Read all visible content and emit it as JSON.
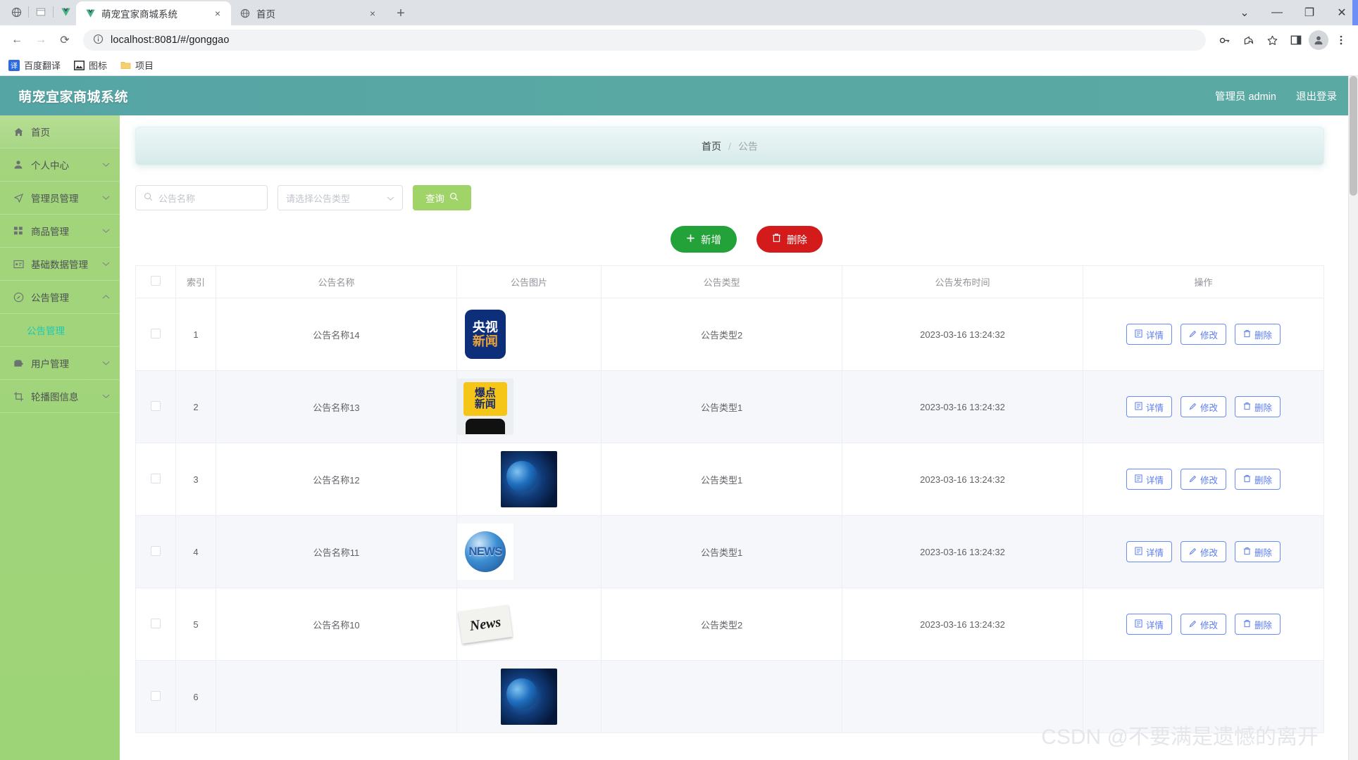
{
  "browser": {
    "tabs": [
      {
        "title": "萌宠宜家商城系统",
        "favicon": "vue-icon",
        "active": true,
        "close_label": "×"
      },
      {
        "title": "首页",
        "favicon": "globe-icon",
        "active": false,
        "close_label": "×"
      }
    ],
    "new_tab_label": "+",
    "leading_icons": [
      "globe-icon",
      "window-icon",
      "vue-icon"
    ],
    "window_controls": {
      "minimize": "—",
      "maximize": "❐",
      "close": "✕",
      "tab_search": "⌄"
    },
    "nav": {
      "back": "←",
      "forward": "→",
      "reload": "⟳"
    },
    "omnibox": {
      "info_icon": "info-circle-icon",
      "host": "localhost:8081",
      "path": "/#/gonggao",
      "full_url": "localhost:8081/#/gonggao"
    },
    "toolbar_icons": [
      "key-icon",
      "share-icon",
      "star-icon",
      "sidepanel-icon",
      "profile-icon",
      "menu-icon"
    ],
    "bookmarks": [
      {
        "label": "百度翻译",
        "icon": "translate-icon",
        "icon_text": "译",
        "icon_color": "#2d6ae0"
      },
      {
        "label": "图标",
        "icon": "image-icon",
        "icon_text": "",
        "icon_color": "#2b2b2b"
      },
      {
        "label": "项目",
        "icon": "folder-icon",
        "icon_text": "",
        "icon_color": "#f2cb50"
      }
    ]
  },
  "app": {
    "title": "萌宠宜家商城系统",
    "header": {
      "user_label": "管理员 admin",
      "logout_label": "退出登录"
    },
    "sidebar": {
      "items": [
        {
          "label": "首页",
          "icon": "home-icon",
          "has_arrow": false,
          "expanded": false,
          "active": true
        },
        {
          "label": "个人中心",
          "icon": "user-icon",
          "has_arrow": true,
          "expanded": false,
          "active": false
        },
        {
          "label": "管理员管理",
          "icon": "navigation-icon",
          "has_arrow": true,
          "expanded": false,
          "active": false
        },
        {
          "label": "商品管理",
          "icon": "grid-icon",
          "has_arrow": true,
          "expanded": false,
          "active": false
        },
        {
          "label": "基础数据管理",
          "icon": "postcard-icon",
          "has_arrow": true,
          "expanded": false,
          "active": false
        },
        {
          "label": "公告管理",
          "icon": "dial-icon",
          "has_arrow": true,
          "expanded": true,
          "active": false
        },
        {
          "label": "用户管理",
          "icon": "wallet-icon",
          "has_arrow": true,
          "expanded": false,
          "active": false
        },
        {
          "label": "轮播图信息",
          "icon": "crop-icon",
          "has_arrow": true,
          "expanded": false,
          "active": false
        }
      ],
      "submenu": {
        "label": "公告管理",
        "parent_index": 5,
        "active": true
      }
    },
    "breadcrumb": {
      "home": "首页",
      "separator": "/",
      "current": "公告"
    },
    "filters": {
      "name_placeholder": "公告名称",
      "name_value": "",
      "name_icon": "search-icon",
      "type_placeholder": "请选择公告类型",
      "type_value": "",
      "type_arrow": "chevron-down-icon",
      "query_label": "查询",
      "query_icon": "search-icon"
    },
    "actions": {
      "add_label": "新增",
      "add_icon": "plus-icon",
      "delete_label": "删除",
      "delete_icon": "trash-icon"
    },
    "table": {
      "columns": [
        "",
        "索引",
        "公告名称",
        "公告图片",
        "公告类型",
        "公告发布时间",
        "操作"
      ],
      "header_checkbox": false,
      "row_actions": [
        {
          "label": "详情",
          "icon": "document-icon"
        },
        {
          "label": "修改",
          "icon": "pencil-icon"
        },
        {
          "label": "删除",
          "icon": "trash-icon"
        }
      ],
      "rows": [
        {
          "checked": false,
          "index": "1",
          "name": "公告名称14",
          "image": "cctv-news",
          "type": "公告类型2",
          "time": "2023-03-16 13:24:32"
        },
        {
          "checked": false,
          "index": "2",
          "name": "公告名称13",
          "image": "baodian-news",
          "type": "公告类型1",
          "time": "2023-03-16 13:24:32"
        },
        {
          "checked": false,
          "index": "3",
          "name": "公告名称12",
          "image": "dark-globe",
          "type": "公告类型1",
          "time": "2023-03-16 13:24:32"
        },
        {
          "checked": false,
          "index": "4",
          "name": "公告名称11",
          "image": "news-globe",
          "type": "公告类型1",
          "time": "2023-03-16 13:24:32"
        },
        {
          "checked": false,
          "index": "5",
          "name": "公告名称10",
          "image": "newspaper",
          "type": "公告类型2",
          "time": "2023-03-16 13:24:32"
        },
        {
          "checked": false,
          "index": "6",
          "name": "",
          "image": "partial",
          "type": "",
          "time": ""
        }
      ]
    },
    "watermark": "CSDN @不要满是遗憾的离开",
    "colors": {
      "header_teal": "#59a8a4",
      "sidebar_green": "#a2d47c",
      "submenu_active": "#21c7b0",
      "query_green": "#a0d468",
      "add_green": "#22a238",
      "delete_red": "#d41b1b",
      "op_blue": "#5b7cf0"
    }
  }
}
